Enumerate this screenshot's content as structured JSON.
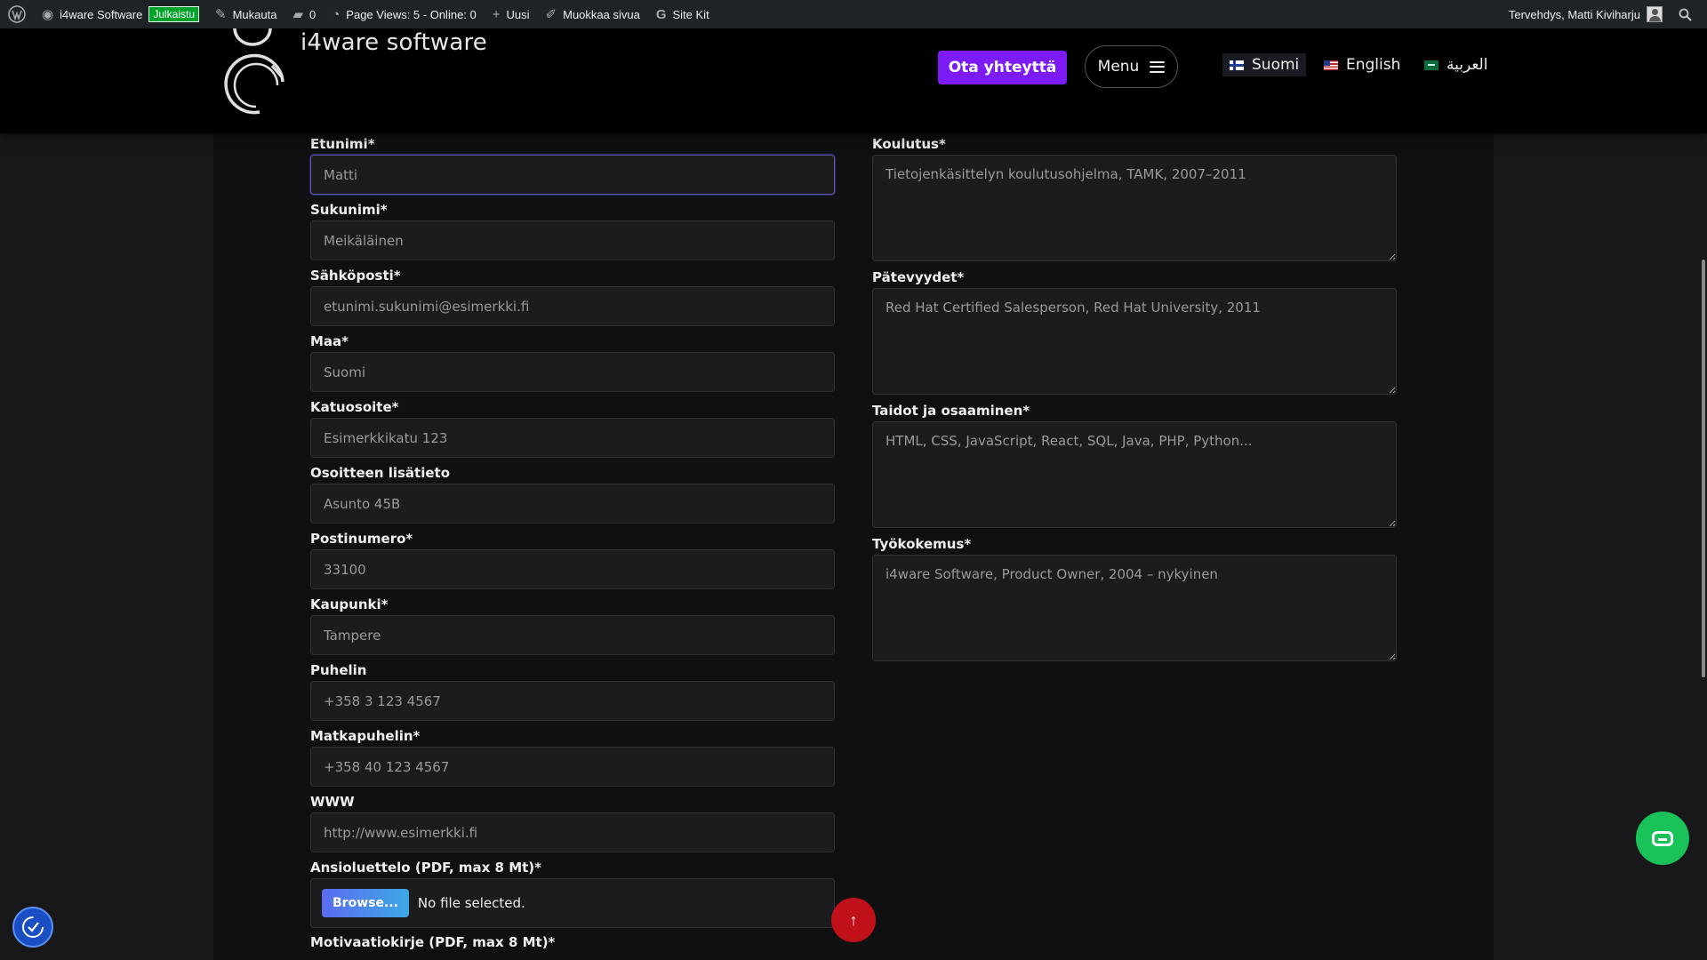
{
  "adminbar": {
    "site_name": "i4ware Software",
    "status_badge": "Julkaistu",
    "customize": "Mukauta",
    "comments_count": "0",
    "page_views": "Page Views: 5 - Online: 0",
    "new": "Uusi",
    "edit_page": "Muokkaa sivua",
    "site_kit": "Site Kit",
    "greeting": "Tervehdys, Matti Kiviharju"
  },
  "header": {
    "logo_text": "i4ware software",
    "cta_label": "Ota yhteyttä",
    "menu_label": "Menu",
    "languages": [
      "Suomi",
      "English",
      "العربية"
    ]
  },
  "form": {
    "left_fields": [
      {
        "label": "Etunimi*",
        "placeholder": "Matti"
      },
      {
        "label": "Sukunimi*",
        "placeholder": "Meikäläinen"
      },
      {
        "label": "Sähköposti*",
        "placeholder": "etunimi.sukunimi@esimerkki.fi"
      },
      {
        "label": "Maa*",
        "placeholder": "Suomi"
      },
      {
        "label": "Katuosoite*",
        "placeholder": "Esimerkkikatu 123"
      },
      {
        "label": "Osoitteen lisätieto",
        "placeholder": "Asunto 45B"
      },
      {
        "label": "Postinumero*",
        "placeholder": "33100"
      },
      {
        "label": "Kaupunki*",
        "placeholder": "Tampere"
      },
      {
        "label": "Puhelin",
        "placeholder": "+358 3 123 4567"
      },
      {
        "label": "Matkapuhelin*",
        "placeholder": "+358 40 123 4567"
      },
      {
        "label": "WWW",
        "placeholder": "http://www.esimerkki.fi"
      }
    ],
    "right_fields": [
      {
        "label": "Koulutus*",
        "placeholder": "Tietojenkäsittelyn koulutusohjelma, TAMK, 2007–2011"
      },
      {
        "label": "Pätevyydet*",
        "placeholder": "Red Hat Certified Salesperson, Red Hat University, 2011"
      },
      {
        "label": "Taidot ja osaaminen*",
        "placeholder": "HTML, CSS, JavaScript, React, SQL, Java, PHP, Python..."
      },
      {
        "label": "Työkokemus*",
        "placeholder": "i4ware Software, Product Owner, 2004 – nykyinen"
      }
    ],
    "cv_label": "Ansioluettelo (PDF, max 8 Mt)*",
    "browse_label": "Browse...",
    "file_status": "No file selected.",
    "next_label": "Motivaatiokirje (PDF, max 8 Mt)*"
  },
  "widgets": {
    "to_top_glyph": "↑"
  },
  "colors": {
    "accent": "#7c1bf5",
    "to_top": "#c0111a",
    "chat": "#19c35a",
    "accessibility": "#1a4fc4"
  }
}
